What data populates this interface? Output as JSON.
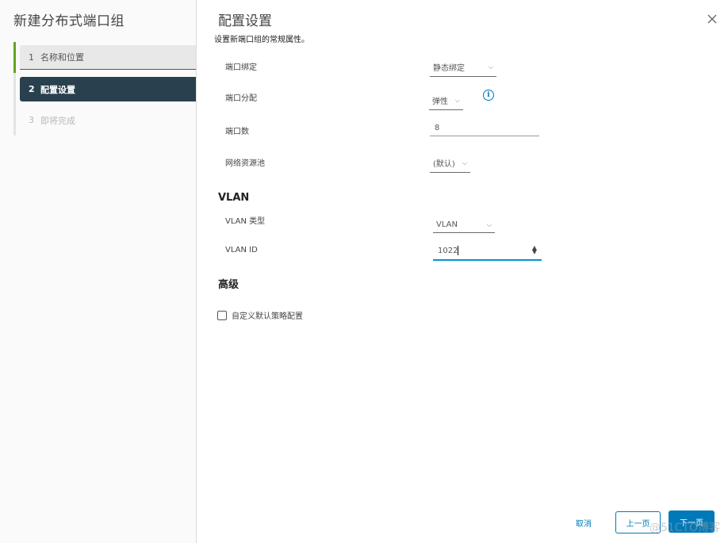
{
  "sidebar": {
    "title": "新建分布式端口组",
    "steps": [
      {
        "num": "1",
        "label": "名称和位置",
        "state": "done"
      },
      {
        "num": "2",
        "label": "配置设置",
        "state": "active"
      },
      {
        "num": "3",
        "label": "即将完成",
        "state": "todo"
      }
    ],
    "accent_color": "#62a420",
    "active_color": "#29414e"
  },
  "main": {
    "title": "配置设置",
    "subtitle": "设置新端口组的常规属性。",
    "close_icon": "close-icon",
    "fields": {
      "port_binding": {
        "label": "端口绑定",
        "value": "静态绑定"
      },
      "port_allocation": {
        "label": "端口分配",
        "value": "弹性",
        "info_icon": "info-icon",
        "info_glyph": "i"
      },
      "port_count": {
        "label": "端口数",
        "value": "8"
      },
      "network_pool": {
        "label": "网络资源池",
        "value": "(默认)"
      }
    },
    "vlan_section": {
      "title": "VLAN",
      "vlan_type": {
        "label": "VLAN 类型",
        "value": "VLAN"
      },
      "vlan_id": {
        "label": "VLAN ID",
        "value": "1022"
      }
    },
    "advanced_section": {
      "title": "高级",
      "custom_policy": {
        "label": "自定义默认策略配置",
        "checked": false
      }
    }
  },
  "footer": {
    "cancel_label": "取消",
    "back_label": "上一页",
    "next_label": "下一页",
    "primary_color": "#0079b8"
  },
  "watermark": "@51CTO博客",
  "chevron_glyph": "⌵",
  "spinner_up": "▲",
  "spinner_down": "▼"
}
